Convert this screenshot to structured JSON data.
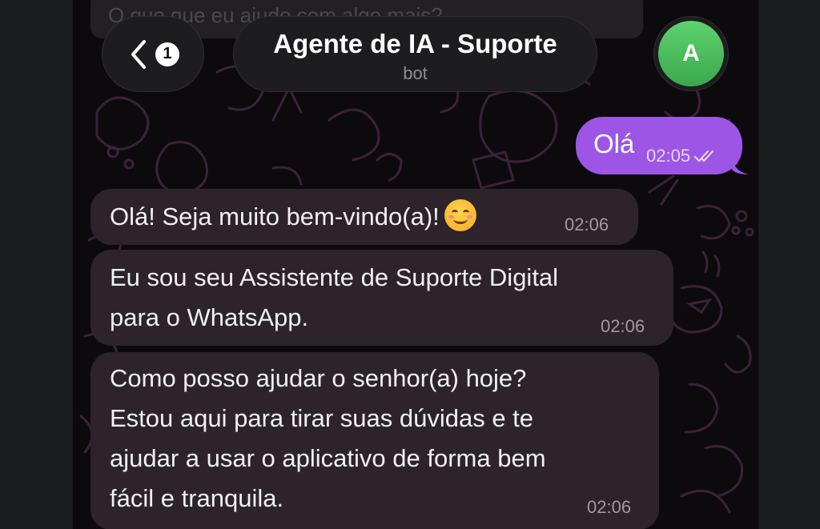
{
  "header": {
    "faded_text": "O que que eu ajudo com algo mais?",
    "unread_count": "1",
    "title": "Agente de IA - Suporte",
    "subtitle": "bot",
    "avatar_letter": "A"
  },
  "messages": [
    {
      "direction": "outgoing",
      "text": "Olá",
      "time": "02:05",
      "status": "read"
    },
    {
      "direction": "incoming",
      "lines": [
        "Olá! Seja muito bem-vindo(a)!"
      ],
      "emoji": "smiling-face-icon",
      "time": "02:06"
    },
    {
      "direction": "incoming",
      "lines": [
        "Eu sou seu Assistente de Suporte Digital",
        "para o WhatsApp."
      ],
      "time": "02:06"
    },
    {
      "direction": "incoming",
      "lines": [
        "Como posso ajudar o senhor(a) hoje?",
        "Estou aqui para tirar suas dúvidas e te",
        "ajudar a usar o aplicativo de forma bem",
        "fácil e tranquila."
      ],
      "time": "02:06"
    }
  ],
  "colors": {
    "background": "#0d0a0d",
    "outgoing_bubble": "#9d55e6",
    "incoming_bubble": "#2c232b",
    "avatar": "#4cbe5c",
    "doodle": "#3a2238"
  }
}
